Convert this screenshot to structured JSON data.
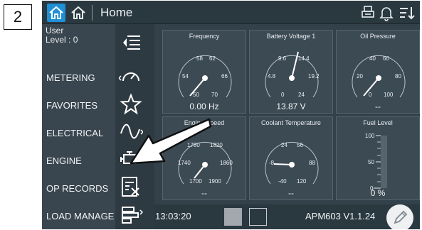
{
  "step_label": "2",
  "header": {
    "title": "Home"
  },
  "user": {
    "name": "User",
    "level": "Level : 0"
  },
  "menu": [
    {
      "label": "METERING"
    },
    {
      "label": "FAVORITES"
    },
    {
      "label": "ELECTRICAL"
    },
    {
      "label": "ENGINE"
    },
    {
      "label": "OP RECORDS"
    },
    {
      "label": "LOAD MANAGE"
    }
  ],
  "gauges": {
    "frequency": {
      "title": "Frequency",
      "value": "0.00 Hz",
      "ticks": [
        "58",
        "62",
        "54",
        "66",
        "50",
        "70"
      ]
    },
    "battery": {
      "title": "Battery Voltage 1",
      "value": "13.87 V",
      "ticks": [
        "9.6",
        "14.4",
        "4.8",
        "19.2",
        "0",
        "24"
      ]
    },
    "oil": {
      "title": "Oil Pressure",
      "value": "--",
      "ticks": [
        "40",
        "60",
        "20",
        "80",
        "0",
        "100"
      ]
    },
    "speed": {
      "title": "Engine Speed",
      "value": "--",
      "ticks": [
        "1780",
        "1820",
        "1740",
        "1860",
        "1700",
        "1900"
      ]
    },
    "coolant": {
      "title": "Coolant Temperature",
      "value": "--",
      "ticks": [
        "24",
        "56",
        "-8",
        "88",
        "-40",
        "120"
      ]
    },
    "fuel": {
      "title": "Fuel Level",
      "value": "0 %",
      "ticks": [
        "100",
        "50",
        "0"
      ]
    }
  },
  "footer": {
    "time": "13:03:20",
    "version": "APM603 V1.1.24"
  },
  "colors": {
    "accent": "#1f8fd6",
    "screen_bg": "#33414b",
    "needle": "#ffffff"
  }
}
